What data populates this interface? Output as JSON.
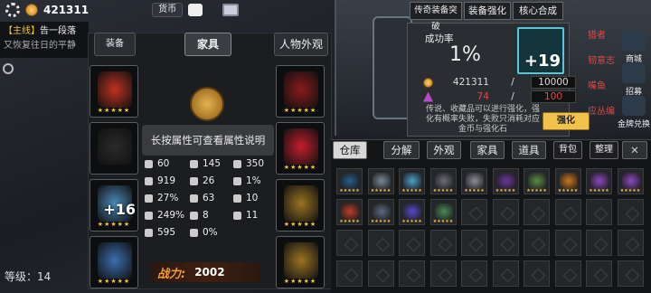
{
  "topbar": {
    "coins": "421311",
    "currency_label": "货币"
  },
  "quest": {
    "tag": "【主线】",
    "title": "告一段落",
    "subtitle": "又恢复往日的平静"
  },
  "player": {
    "level_label": "等级：",
    "level": "14"
  },
  "panel": {
    "tabs": [
      "装备",
      "家具",
      "人物外观"
    ],
    "active_tab": "家具",
    "tooltip": "长按属性可查看属性说明",
    "power_label": "战力:",
    "power_value": "2002",
    "left_slots": [
      {
        "name": "red-helmet",
        "color": "#c0321e",
        "stars": "★★★★★",
        "badge": ""
      },
      {
        "name": "empty-armor",
        "color": "#2a2a2c",
        "stars": "",
        "badge": ""
      },
      {
        "name": "blue-gloves",
        "color": "#4a8ab8",
        "stars": "★★★★★",
        "badge": "+16"
      },
      {
        "name": "blue-boots",
        "color": "#3a6fb0",
        "stars": "★★★★★",
        "badge": ""
      }
    ],
    "right_slots": [
      {
        "name": "red-blade",
        "color": "#8a1a1a",
        "stars": "★★★★★",
        "badge": ""
      },
      {
        "name": "red-orb",
        "color": "#c41e2a",
        "stars": "★★★★★",
        "badge": ""
      },
      {
        "name": "gold-star",
        "color": "#9a7420",
        "stars": "★★★★★",
        "badge": ""
      },
      {
        "name": "gold-star-2",
        "color": "#9a7420",
        "stars": "★★★★★",
        "badge": ""
      }
    ],
    "stats": [
      {
        "icon": "attack-icon",
        "value": "60"
      },
      {
        "icon": "speed-icon",
        "value": "145"
      },
      {
        "icon": "pierce-icon",
        "value": "350"
      },
      {
        "icon": "hp-icon",
        "value": "919"
      },
      {
        "icon": "heal-icon",
        "value": "26"
      },
      {
        "icon": "crit-icon",
        "value": "1%"
      },
      {
        "icon": "critdmg-icon",
        "value": "27%"
      },
      {
        "icon": "dodge-icon",
        "value": "63"
      },
      {
        "icon": "accuracy-icon",
        "value": "10"
      },
      {
        "icon": "damage-icon",
        "value": "249%"
      },
      {
        "icon": "defense-icon",
        "value": "8"
      },
      {
        "icon": "fire-icon",
        "value": "11"
      },
      {
        "icon": "recovery-icon",
        "value": "595"
      },
      {
        "icon": "lifesteal-icon",
        "value": "0%"
      }
    ]
  },
  "enhance": {
    "tabs": [
      "传奇装备突破",
      "装备强化",
      "核心合成"
    ],
    "success_label": "成功率",
    "success_value": "1%",
    "item_badge": "+19",
    "cost_gold_have": "421311",
    "cost_gold_need": "10000",
    "cost_crystal_have": "74",
    "cost_crystal_need": "100",
    "cost_sep": "/",
    "description": "传说、收藏品可以进行强化，强化有概率失败，失败只消耗对应金币与强化石",
    "button": "强化"
  },
  "side_menu": [
    {
      "label": "商城",
      "icon": "shop-icon"
    },
    {
      "label": "招募",
      "icon": "recruit-icon"
    },
    {
      "label": "金牌兑换",
      "icon": "exchange-icon"
    }
  ],
  "red_labels": [
    "猎者",
    "韧意志",
    "嘴鱼",
    "应丛编"
  ],
  "inventory": {
    "tabs": [
      "仓库",
      "分解",
      "外观",
      "家具",
      "道具",
      "背包",
      "整理"
    ],
    "active_tab": "仓库",
    "items": [
      {
        "name": "helmet-blue",
        "color": "#2a5c8a"
      },
      {
        "name": "scanner",
        "color": "#7a8a9a"
      },
      {
        "name": "boots-blue",
        "color": "#4aa0c8"
      },
      {
        "name": "armor-grey",
        "color": "#6a6f78"
      },
      {
        "name": "bracelet-grey",
        "color": "#8a8f98"
      },
      {
        "name": "armor-purple",
        "color": "#6a3a9a"
      },
      {
        "name": "blade-green",
        "color": "#5a8a4a"
      },
      {
        "name": "burst-orange",
        "color": "#c87820"
      },
      {
        "name": "gem-purple",
        "color": "#8a4ac0"
      },
      {
        "name": "gem-purple-2",
        "color": "#8a4ac0"
      },
      {
        "name": "crystal-red",
        "color": "#b8402a"
      },
      {
        "name": "helmet-steel",
        "color": "#5a6a80"
      },
      {
        "name": "orb-purple",
        "color": "#5a4ac8"
      },
      {
        "name": "helmet-green",
        "color": "#4a8a5a"
      }
    ]
  }
}
